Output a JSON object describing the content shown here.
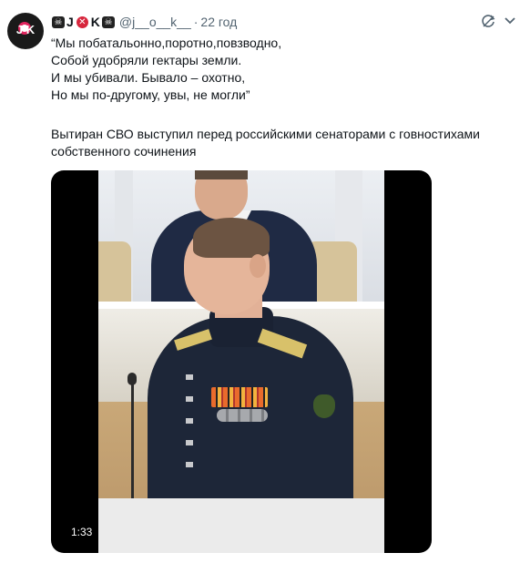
{
  "tweet": {
    "avatar_text": "J K",
    "author": {
      "name_part1": "J",
      "name_part2": "K",
      "handle": "@j__o__k__",
      "time": "22 год"
    },
    "text_lines": [
      "“Мы побатальонно,поротно,повзводно,",
      "Собой удобряли гектары земли.",
      "И мы убивали. Бывало – охотно,",
      "Но мы по-другому, увы, не могли”"
    ],
    "caption_lines": [
      "Вытиран СВО выступил перед российскими сенаторами с говностихами",
      "собственного сочинения"
    ],
    "media": {
      "duration": "1:33"
    },
    "icons": {
      "repeat": "repeat-icon",
      "more": "more-icon",
      "skull": "skull-icon",
      "cross": "cross-icon"
    },
    "colors": {
      "text": "#0f1419",
      "secondary": "#536471",
      "accent": "#d7263d"
    }
  }
}
